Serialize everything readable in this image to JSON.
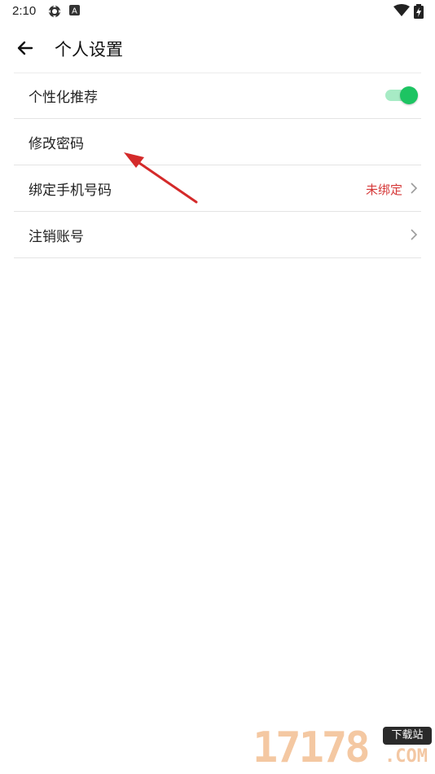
{
  "status_bar": {
    "time": "2:10",
    "icons": [
      "settings-gear-icon",
      "a-badge-icon",
      "wifi-icon",
      "battery-charging-icon"
    ]
  },
  "app_bar": {
    "back_icon": "arrow-left-icon",
    "title": "个人设置"
  },
  "settings": {
    "items": [
      {
        "label": "个性化推荐",
        "control": "toggle",
        "toggle_on": true
      },
      {
        "label": "修改密码"
      },
      {
        "label": "绑定手机号码",
        "value": "未绑定",
        "chevron": true
      },
      {
        "label": "注销账号",
        "chevron": true
      }
    ]
  },
  "annotation": {
    "type": "arrow",
    "color": "#d42a2a",
    "points_to": "修改密码"
  },
  "watermark": {
    "digits": "17178",
    "badge": "下载站",
    "com": ".COM"
  },
  "colors": {
    "accent_green": "#1dc462",
    "unbound_red": "#d63a3a"
  }
}
